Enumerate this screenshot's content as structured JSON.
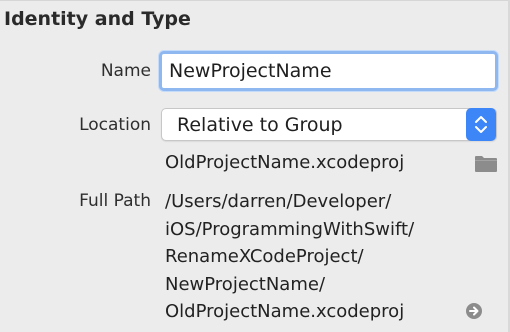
{
  "section": {
    "title": "Identity and Type"
  },
  "name": {
    "label": "Name",
    "value": "NewProjectName"
  },
  "location": {
    "label": "Location",
    "selected": "Relative to Group",
    "file": "OldProjectName.xcodeproj"
  },
  "full_path": {
    "label": "Full Path",
    "lines": [
      "/Users/darren/Developer/",
      "iOS/ProgrammingWithSwift/",
      "RenameXCodeProject/",
      "NewProjectName/",
      "OldProjectName.xcodeproj"
    ]
  },
  "icons": {
    "folder": "folder-icon",
    "reveal": "arrow-circle-right-icon",
    "stepper": "chevron-up-down-icon"
  },
  "colors": {
    "accent": "#3d86f7",
    "focus_ring": "#8fb8f0",
    "background": "#ececec",
    "icon_gray": "#8c8c8c"
  }
}
